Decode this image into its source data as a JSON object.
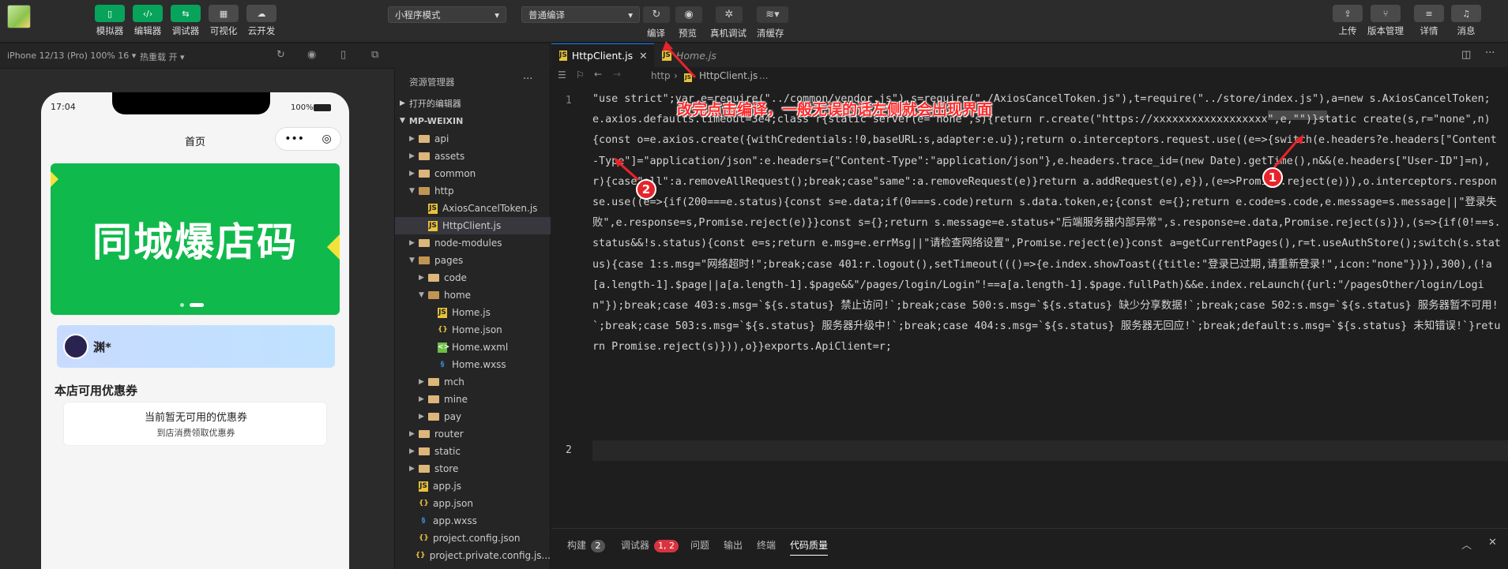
{
  "toolbar": {
    "left_buttons": [
      {
        "label": "模拟器",
        "icon": "phone-icon"
      },
      {
        "label": "编辑器",
        "icon": "code-icon"
      },
      {
        "label": "调试器",
        "icon": "debug-icon"
      },
      {
        "label": "可视化",
        "icon": "layout-icon"
      },
      {
        "label": "云开发",
        "icon": "cloud-icon"
      }
    ],
    "mode_select": "小程序模式",
    "compile_select": "普通编译",
    "center_labels": {
      "compile": "编译",
      "preview": "预览",
      "real_debug": "真机调试",
      "clear_cache": "清缓存"
    },
    "right_buttons": [
      {
        "label": "上传",
        "icon": "upload-icon"
      },
      {
        "label": "版本管理",
        "icon": "branch-icon"
      },
      {
        "label": "详情",
        "icon": "menu-icon"
      },
      {
        "label": "消息",
        "icon": "bell-icon"
      }
    ]
  },
  "simulator": {
    "device": "iPhone 12/13 (Pro) 100% 16 ▾",
    "hotreload": "热重载 开 ▾",
    "status_time": "17:04",
    "battery": "100%",
    "nav_title": "首页",
    "banner_text": "同城爆店码",
    "user_name": "渊*",
    "section_title": "本店可用优惠券",
    "coupon_empty": "当前暂无可用的优惠券",
    "coupon_hint": "到店消费领取优惠券"
  },
  "explorer": {
    "title": "资源管理器",
    "open_editors": "打开的编辑器",
    "project": "MP-WEIXIN",
    "tree": [
      {
        "name": "api",
        "type": "folder",
        "depth": 1
      },
      {
        "name": "assets",
        "type": "folder",
        "depth": 1
      },
      {
        "name": "common",
        "type": "folder",
        "depth": 1
      },
      {
        "name": "http",
        "type": "folder-open",
        "depth": 1
      },
      {
        "name": "AxiosCancelToken.js",
        "type": "js",
        "depth": 2
      },
      {
        "name": "HttpClient.js",
        "type": "js",
        "depth": 2,
        "selected": true
      },
      {
        "name": "node-modules",
        "type": "folder",
        "depth": 1
      },
      {
        "name": "pages",
        "type": "folder-open",
        "depth": 1
      },
      {
        "name": "code",
        "type": "folder",
        "depth": 2
      },
      {
        "name": "home",
        "type": "folder-open",
        "depth": 2
      },
      {
        "name": "Home.js",
        "type": "js",
        "depth": 3
      },
      {
        "name": "Home.json",
        "type": "json",
        "depth": 3
      },
      {
        "name": "Home.wxml",
        "type": "wxml",
        "depth": 3
      },
      {
        "name": "Home.wxss",
        "type": "wxss",
        "depth": 3
      },
      {
        "name": "mch",
        "type": "folder",
        "depth": 2
      },
      {
        "name": "mine",
        "type": "folder",
        "depth": 2
      },
      {
        "name": "pay",
        "type": "folder",
        "depth": 2
      },
      {
        "name": "router",
        "type": "folder",
        "depth": 1
      },
      {
        "name": "static",
        "type": "folder",
        "depth": 1
      },
      {
        "name": "store",
        "type": "folder",
        "depth": 1
      },
      {
        "name": "app.js",
        "type": "js",
        "depth": 1
      },
      {
        "name": "app.json",
        "type": "json",
        "depth": 1
      },
      {
        "name": "app.wxss",
        "type": "wxss",
        "depth": 1
      },
      {
        "name": "project.config.json",
        "type": "json",
        "depth": 1
      },
      {
        "name": "project.private.config.js...",
        "type": "json",
        "depth": 1
      }
    ]
  },
  "editor": {
    "tabs": [
      {
        "label": "HttpClient.js",
        "active": true
      },
      {
        "label": "Home.js",
        "active": false
      }
    ],
    "breadcrumb": [
      "http",
      "HttpClient.js",
      "..."
    ],
    "line_numbers": [
      "1",
      "2"
    ],
    "code_line1": "\"use strict\";var e=require(\"../common/vendor.js\"),s=require(\"./AxiosCancelToken.js\"),t=require(\"../store/index.js\"),a=new s.AxiosCancelToken;e.axios.defaults.timeout=3e4;class r{static server(e=\"none\",s){return r.create(\"https://xxxxxxxxxxxxxxxxxx\",e,\"\")}static create(s,r=\"none\",n){const o=e.axios.create({withCredentials:!0,baseURL:s,adapter:e.u});return o.interceptors.request.use((e=>{switch(e.headers?e.headers[\"Content-Type\"]=\"application/json\":e.headers={\"Content-Type\":\"application/json\"},e.headers.trace_id=(new Date).getTime(),n&&(e.headers[\"User-ID\"]=n),r){case\"all\":a.removeAllRequest();break;case\"same\":a.removeRequest(e)}return a.addRequest(e),e}),(e=>Promise.reject(e))),o.interceptors.response.use((e=>{if(200===e.status){const s=e.data;if(0===s.code)return s.data.token,e;{const e={};return e.code=s.code,e.message=s.message||\"登录失败\",e.response=s,Promise.reject(e)}}const s={};return s.message=e.status+\"后端服务器内部异常\",s.response=e.data,Promise.reject(s)}),(s=>{if(0!==s.status&&!s.status){const e=s;return e.msg=e.errMsg||\"请检查网络设置\",Promise.reject(e)}const a=getCurrentPages(),r=t.useAuthStore();switch(s.status){case 1:s.msg=\"网络超时!\";break;case 401:r.logout(),setTimeout((()=>{e.index.showToast({title:\"登录已过期,请重新登录!\",icon:\"none\"})}),300),(!a[a.length-1].$page||a[a.length-1].$page&&\"/pages/login/Login\"!==a[a.length-1].$page.fullPath)&&e.index.reLaunch({url:\"/pagesOther/login/Login\"});break;case 403:s.msg=`${s.status} 禁止访问!`;break;case 500:s.msg=`${s.status} 缺少分享数据!`;break;case 502:s.msg=`${s.status} 服务器暂不可用!`;break;case 503:s.msg=`${s.status} 服务器升级中!`;break;case 404:s.msg=`${s.status} 服务器无回应!`;break;default:s.msg=`${s.status} 未知错误!`}return Promise.reject(s)})),o}}exports.ApiClient=r;"
  },
  "annotation": {
    "text": "改完点击编译，一般无误的话左侧就会出现界面",
    "marker1": "1",
    "marker2": "2",
    "color": "#ff2a2a"
  },
  "bottom_panel": {
    "tabs": [
      {
        "label": "构建",
        "badge": "2"
      },
      {
        "label": "调试器",
        "badge": "1, 2"
      },
      {
        "label": "问题",
        "badge": ""
      },
      {
        "label": "输出",
        "badge": ""
      },
      {
        "label": "终端",
        "badge": ""
      },
      {
        "label": "代码质量",
        "badge": ""
      }
    ]
  },
  "colors": {
    "accent_green": "#07a35a",
    "editor_bg": "#1e1e1e",
    "sidebar_bg": "#252526"
  }
}
